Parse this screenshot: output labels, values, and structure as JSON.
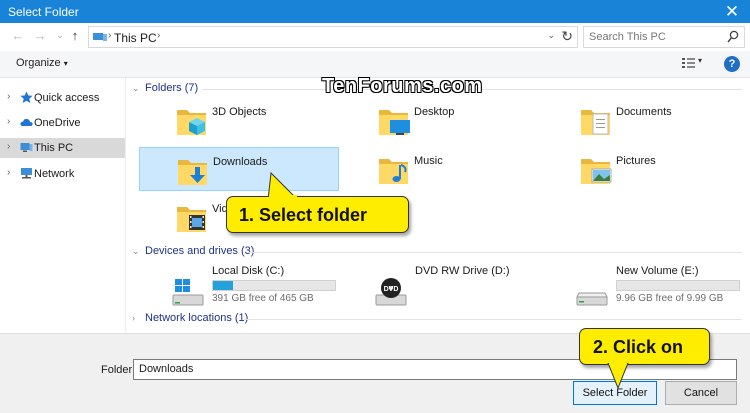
{
  "window": {
    "title": "Select Folder",
    "close_glyph": "✕"
  },
  "nav": {
    "back_glyph": "←",
    "forward_glyph": "→",
    "recent_glyph": "⌄",
    "up_glyph": "↑",
    "breadcrumb": "This PC",
    "sep_glyph": "›",
    "dropdown_glyph": "⌄",
    "refresh_glyph": "↻"
  },
  "search": {
    "placeholder": "Search This PC"
  },
  "toolbar": {
    "organize_label": "Organize",
    "organize_arrow": "▾",
    "view_arrow": "▾",
    "help_glyph": "?"
  },
  "sidebar": {
    "chevron": "›",
    "items": [
      {
        "label": "Quick access",
        "icon": "star-icon"
      },
      {
        "label": "OneDrive",
        "icon": "cloud-icon"
      },
      {
        "label": "This PC",
        "icon": "computer-icon"
      },
      {
        "label": "Network",
        "icon": "network-icon"
      }
    ]
  },
  "content": {
    "chev_open": "⌄",
    "chev_closed": "›",
    "groups": {
      "folders": "Folders (7)",
      "devices": "Devices and drives (3)",
      "network": "Network locations (1)"
    },
    "folders": [
      {
        "label": "3D Objects",
        "icon": "3d-objects-folder-icon"
      },
      {
        "label": "Desktop",
        "icon": "desktop-folder-icon"
      },
      {
        "label": "Documents",
        "icon": "documents-folder-icon"
      },
      {
        "label": "Downloads",
        "icon": "downloads-folder-icon"
      },
      {
        "label": "Music",
        "icon": "music-folder-icon"
      },
      {
        "label": "Pictures",
        "icon": "pictures-folder-icon"
      },
      {
        "label": "Vid",
        "icon": "videos-folder-icon"
      }
    ],
    "drives": [
      {
        "name": "Local Disk (C:)",
        "free": "391 GB free of 465 GB",
        "used_fraction": 0.16,
        "icon": "windows-drive-icon"
      },
      {
        "name": "DVD RW Drive (D:)",
        "icon": "dvd-drive-icon"
      },
      {
        "name": "New Volume (E:)",
        "free": "9.96 GB free of 9.99 GB",
        "used_fraction": 0.0,
        "icon": "hard-drive-icon"
      }
    ]
  },
  "watermark": "TenForums.com",
  "callouts": {
    "select": "1. Select  folder",
    "click": "2. Click on"
  },
  "footer": {
    "folder_label": "Folder:",
    "folder_value": "Downloads",
    "select_button": "Select Folder",
    "cancel_button": "Cancel"
  },
  "colors": {
    "titlebar": "#1883d7",
    "selection": "#cce8ff",
    "callout": "#ffed00",
    "drive_bar": "#26a0da",
    "group_label": "#1e3287"
  }
}
